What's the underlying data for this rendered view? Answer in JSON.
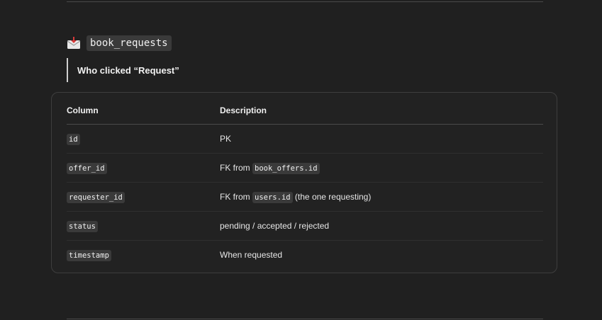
{
  "section": {
    "emoji_icon": "incoming-envelope-icon",
    "title": "book_requests",
    "quote": "Who clicked “Request”"
  },
  "table": {
    "headers": [
      "Column",
      "Description"
    ],
    "rows": [
      {
        "column": "id",
        "desc_prefix": "PK",
        "desc_code": "",
        "desc_suffix": ""
      },
      {
        "column": "offer_id",
        "desc_prefix": "FK from ",
        "desc_code": "book_offers.id",
        "desc_suffix": ""
      },
      {
        "column": "requester_id",
        "desc_prefix": "FK from ",
        "desc_code": "users.id",
        "desc_suffix": " (the one requesting)"
      },
      {
        "column": "status",
        "desc_prefix": "pending / accepted / rejected",
        "desc_code": "",
        "desc_suffix": ""
      },
      {
        "column": "timestamp",
        "desc_prefix": "When requested",
        "desc_code": "",
        "desc_suffix": ""
      }
    ]
  }
}
